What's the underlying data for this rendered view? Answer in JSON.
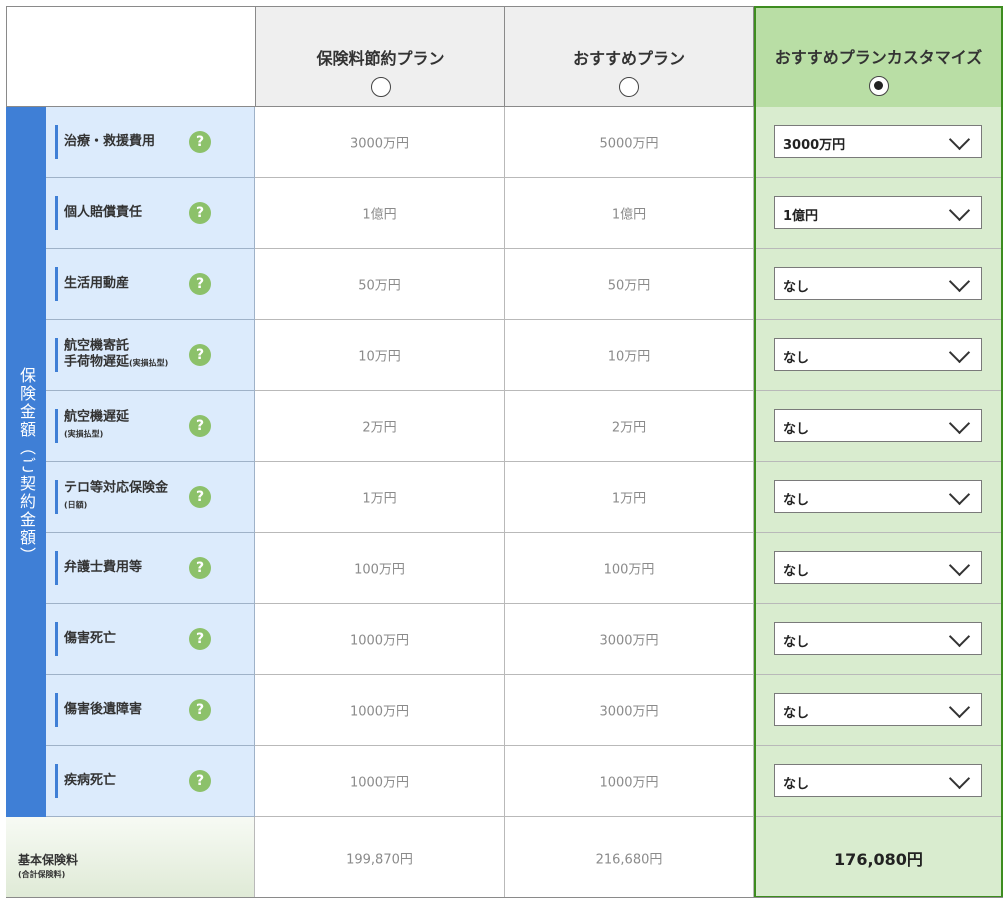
{
  "plans": [
    {
      "name": "保険料節約プラン",
      "selected": false
    },
    {
      "name": "おすすめプラン",
      "selected": false
    },
    {
      "name": "おすすめプランカスタマイズ",
      "selected": true
    }
  ],
  "sidebar_label": "保険金額（ご契約金額）",
  "rows": [
    {
      "label": "治療・救援費用",
      "sub": "",
      "saving": "3000万円",
      "recommended": "5000万円",
      "custom": "3000万円"
    },
    {
      "label": "個人賠償責任",
      "sub": "",
      "saving": "1億円",
      "recommended": "1億円",
      "custom": "1億円"
    },
    {
      "label": "生活用動産",
      "sub": "",
      "saving": "50万円",
      "recommended": "50万円",
      "custom": "なし"
    },
    {
      "label": "航空機寄託",
      "label2": "手荷物遅延",
      "sub": "(実損払型)",
      "saving": "10万円",
      "recommended": "10万円",
      "custom": "なし"
    },
    {
      "label": "航空機遅延",
      "sub": "(実損払型)",
      "saving": "2万円",
      "recommended": "2万円",
      "custom": "なし"
    },
    {
      "label": "テロ等対応保険金",
      "sub": "(日額)",
      "saving": "1万円",
      "recommended": "1万円",
      "custom": "なし"
    },
    {
      "label": "弁護士費用等",
      "sub": "",
      "saving": "100万円",
      "recommended": "100万円",
      "custom": "なし"
    },
    {
      "label": "傷害死亡",
      "sub": "",
      "saving": "1000万円",
      "recommended": "3000万円",
      "custom": "なし"
    },
    {
      "label": "傷害後遺障害",
      "sub": "",
      "saving": "1000万円",
      "recommended": "3000万円",
      "custom": "なし"
    },
    {
      "label": "疾病死亡",
      "sub": "",
      "saving": "1000万円",
      "recommended": "1000万円",
      "custom": "なし"
    }
  ],
  "footer": {
    "label": "基本保険料",
    "sublabel": "(合計保険料)",
    "saving": "199,870円",
    "recommended": "216,680円",
    "custom": "176,080円"
  },
  "help_icon": "question-circle-icon",
  "colors": {
    "blue": "#3f7fd6",
    "green": "#8cc16a",
    "custom_bg": "#d9eccf",
    "custom_border": "#3d8c1f"
  }
}
